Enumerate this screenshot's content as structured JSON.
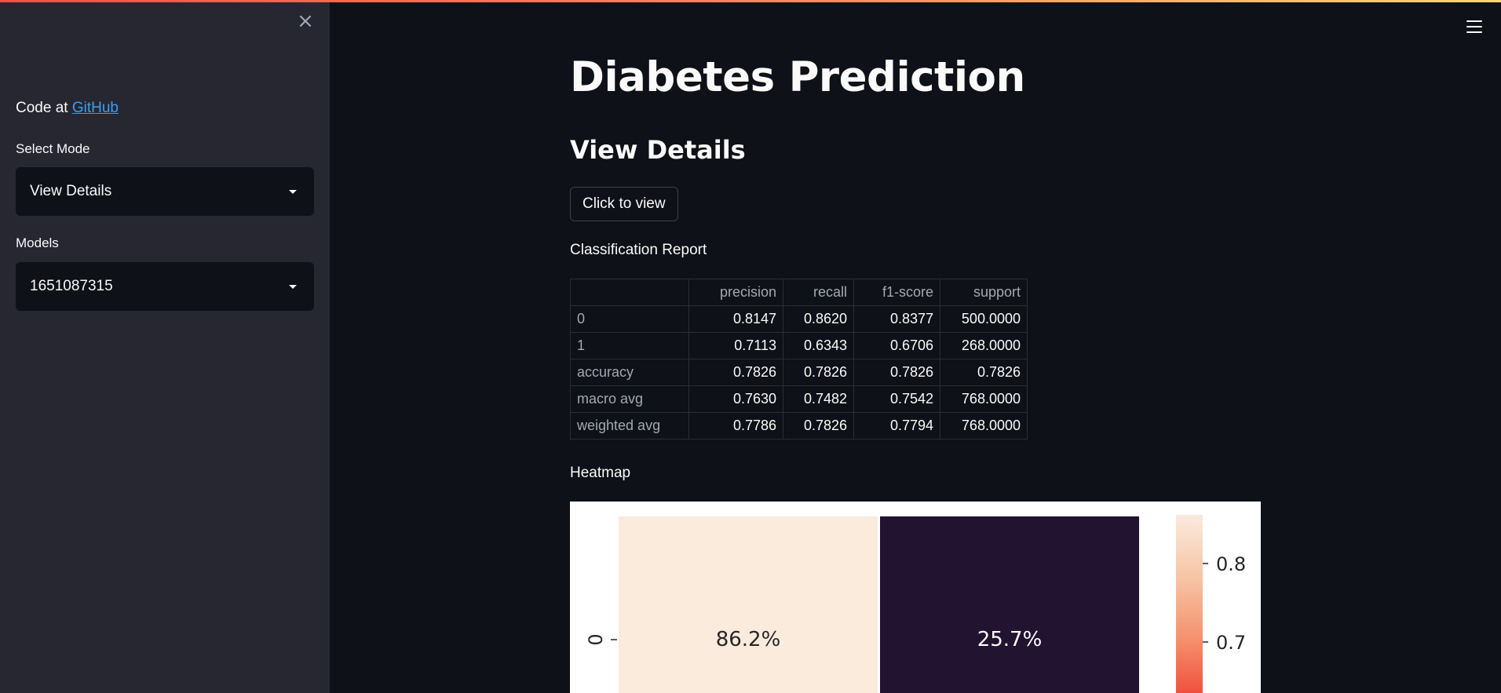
{
  "sidebar": {
    "close_label": "×",
    "code_prefix": "Code at",
    "code_link": "GitHub",
    "mode_label": "Select Mode",
    "mode_value": "View Details",
    "models_label": "Models",
    "models_value": "1651087315"
  },
  "main": {
    "title": "Diabetes Prediction",
    "section_title": "View Details",
    "button_label": "Click to view",
    "report_label": "Classification Report",
    "heatmap_label": "Heatmap"
  },
  "report": {
    "columns": [
      "",
      "precision",
      "recall",
      "f1-score",
      "support"
    ],
    "rows": [
      {
        "label": "0",
        "values": [
          "0.8147",
          "0.8620",
          "0.8377",
          "500.0000"
        ]
      },
      {
        "label": "1",
        "values": [
          "0.7113",
          "0.6343",
          "0.6706",
          "268.0000"
        ]
      },
      {
        "label": "accuracy",
        "values": [
          "0.7826",
          "0.7826",
          "0.7826",
          "0.7826"
        ]
      },
      {
        "label": "macro avg",
        "values": [
          "0.7630",
          "0.7482",
          "0.7542",
          "768.0000"
        ]
      },
      {
        "label": "weighted avg",
        "values": [
          "0.7786",
          "0.7826",
          "0.7794",
          "768.0000"
        ]
      }
    ]
  },
  "colors": {
    "accent": "#ff4b4b",
    "link": "#3d9df3",
    "sidebar_bg": "#262730",
    "main_bg": "#0e1117"
  },
  "chart_data": {
    "type": "heatmap",
    "title": "",
    "row_labels": [
      "0"
    ],
    "col_labels": [
      "",
      ""
    ],
    "values": [
      [
        86.2,
        25.7
      ]
    ],
    "cell_labels": [
      [
        "86.2%",
        "25.7%"
      ]
    ],
    "cell_colors": [
      [
        "#faebdd",
        "#221331"
      ]
    ],
    "colorbar_ticks": [
      "0.8",
      "0.7"
    ],
    "colorbar_tick_values": [
      0.8,
      0.7
    ],
    "colorbar_range": [
      0.6,
      0.862
    ]
  }
}
